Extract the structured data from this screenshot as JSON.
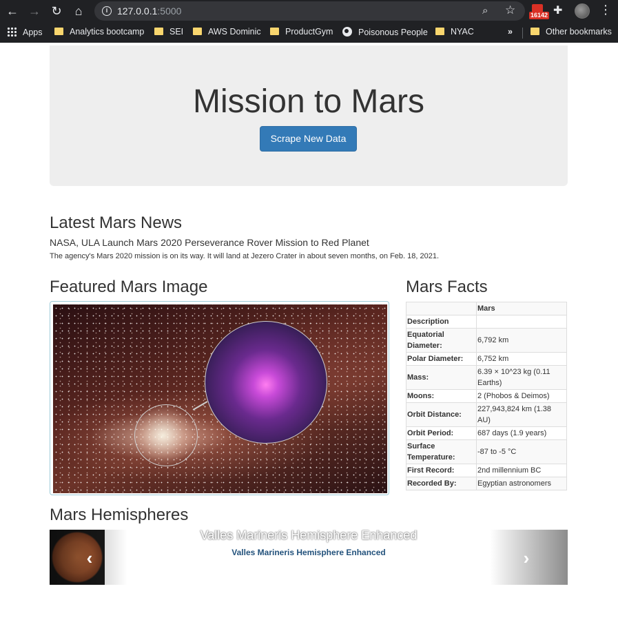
{
  "browser": {
    "url_host": "127.0.0.1",
    "url_port": ":5000",
    "mail_badge": "16142",
    "more_bookmarks": "»",
    "bookmarks": [
      {
        "label": "Apps",
        "icon": "apps-grid-icon"
      },
      {
        "label": "Analytics bootcamp",
        "icon": "folder-icon"
      },
      {
        "label": "SEI",
        "icon": "folder-icon"
      },
      {
        "label": "AWS Dominic",
        "icon": "folder-icon"
      },
      {
        "label": "ProductGym",
        "icon": "folder-icon"
      },
      {
        "label": "Poisonous People",
        "icon": "globe-icon"
      },
      {
        "label": "NYAC",
        "icon": "folder-icon"
      },
      {
        "label": "Other bookmarks",
        "icon": "folder-icon"
      }
    ]
  },
  "jumbotron": {
    "title": "Mission to Mars",
    "button_label": "Scrape New Data"
  },
  "news": {
    "heading": "Latest Mars News",
    "title": "NASA, ULA Launch Mars 2020 Perseverance Rover Mission to Red Planet",
    "teaser": "The agency's Mars 2020 mission is on its way. It will land at Jezero Crater in about seven months, on Feb. 18, 2021."
  },
  "featured": {
    "heading": "Featured Mars Image"
  },
  "facts": {
    "heading": "Mars Facts",
    "column_header": "Mars",
    "rows": [
      {
        "key": "Description",
        "value": ""
      },
      {
        "key": "Equatorial Diameter:",
        "value": "6,792 km"
      },
      {
        "key": "Polar Diameter:",
        "value": "6,752 km"
      },
      {
        "key": "Mass:",
        "value": "6.39 × 10^23 kg (0.11 Earths)"
      },
      {
        "key": "Moons:",
        "value": "2 (Phobos & Deimos)"
      },
      {
        "key": "Orbit Distance:",
        "value": "227,943,824 km (1.38 AU)"
      },
      {
        "key": "Orbit Period:",
        "value": "687 days (1.9 years)"
      },
      {
        "key": "Surface Temperature:",
        "value": "-87 to -5 °C"
      },
      {
        "key": "First Record:",
        "value": "2nd millennium BC"
      },
      {
        "key": "Recorded By:",
        "value": "Egyptian astronomers"
      }
    ]
  },
  "hemispheres": {
    "heading": "Mars Hemispheres",
    "caption": "Valles Marineris Hemisphere Enhanced",
    "link": "Valles Marineris Hemisphere Enhanced"
  }
}
